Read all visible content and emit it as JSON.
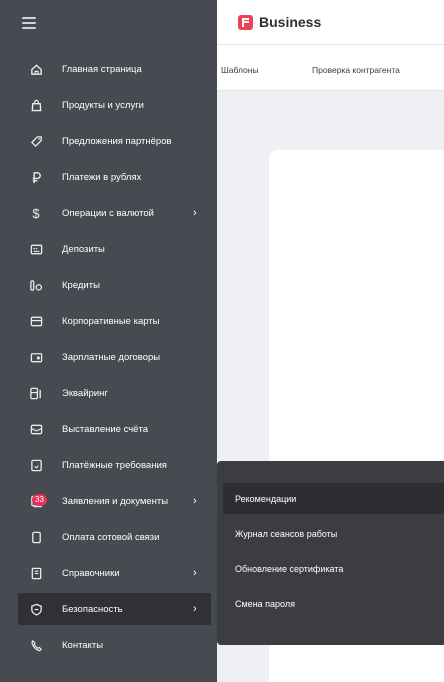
{
  "sidebar": {
    "items": [
      {
        "icon": "home-icon",
        "label": "Главная страница"
      },
      {
        "icon": "shopping-bag-icon",
        "label": "Продукты и услуги"
      },
      {
        "icon": "tag-icon",
        "label": "Предложения партнёров"
      },
      {
        "icon": "ruble-icon",
        "label": "Платежи в рублях"
      },
      {
        "icon": "dollar-icon",
        "label": "Операции с валютой",
        "chevron": "›"
      },
      {
        "icon": "deposit-icon",
        "label": "Депозиты"
      },
      {
        "icon": "credit-icon",
        "label": "Кредиты"
      },
      {
        "icon": "card-icon",
        "label": "Корпоративные карты"
      },
      {
        "icon": "salary-card-icon",
        "label": "Зарплатные договоры"
      },
      {
        "icon": "pos-terminal-icon",
        "label": "Эквайринг"
      },
      {
        "icon": "envelope-icon",
        "label": "Выставление счёта"
      },
      {
        "icon": "document-icon",
        "label": "Платёжные требования"
      },
      {
        "icon": "documents-icon",
        "label": "Заявления и документы",
        "chevron": "›",
        "badge": "33"
      },
      {
        "icon": "phone-icon",
        "label": "Оплата сотовой связи"
      },
      {
        "icon": "book-icon",
        "label": "Справочники",
        "chevron": "›"
      },
      {
        "icon": "shield-icon",
        "label": "Безопасность",
        "chevron": "›",
        "active": true
      },
      {
        "icon": "contacts-icon",
        "label": "Контакты"
      }
    ]
  },
  "header": {
    "logo_text": "Business"
  },
  "subnav": {
    "tabs": [
      "Шаблоны",
      "Проверка контрагента"
    ]
  },
  "submenu": {
    "items": [
      "Рекомендации",
      "Журнал сеансов работы",
      "Обновление сертификата",
      "Смена пароля"
    ]
  },
  "colors": {
    "sidebar_bg": "#474a51",
    "active_bg": "#2f3136",
    "brand": "#ee4058",
    "badge": "#e5325a"
  }
}
